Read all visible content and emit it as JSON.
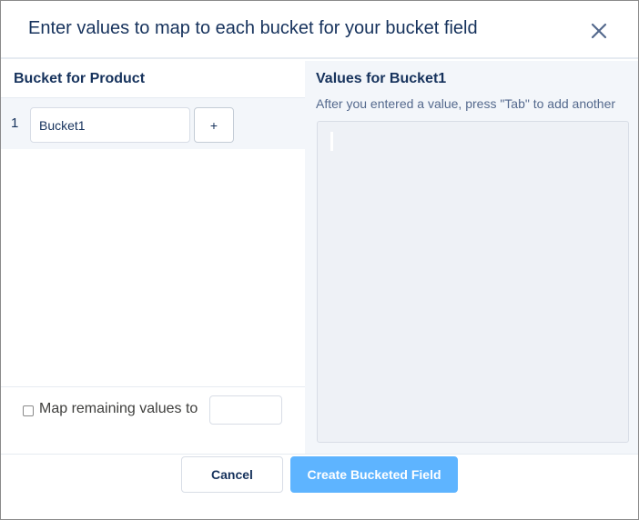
{
  "dialog": {
    "title": "Enter values to map to each bucket for your bucket field",
    "close_icon": "close-icon"
  },
  "left": {
    "header": "Bucket for Product",
    "buckets": [
      {
        "number": "1",
        "name": "Bucket1"
      }
    ],
    "add_label": "+",
    "remaining": {
      "checked": false,
      "label": "Map remaining values to",
      "value": ""
    }
  },
  "right": {
    "header": "Values for Bucket1",
    "hint": "After you entered a value, press \"Tab\" to add another",
    "values": ""
  },
  "footer": {
    "cancel_label": "Cancel",
    "create_label": "Create Bucketed Field"
  },
  "colors": {
    "primary_button": "#5eb4ff",
    "panel_background": "#f3f6fa",
    "text": "#16325c"
  }
}
